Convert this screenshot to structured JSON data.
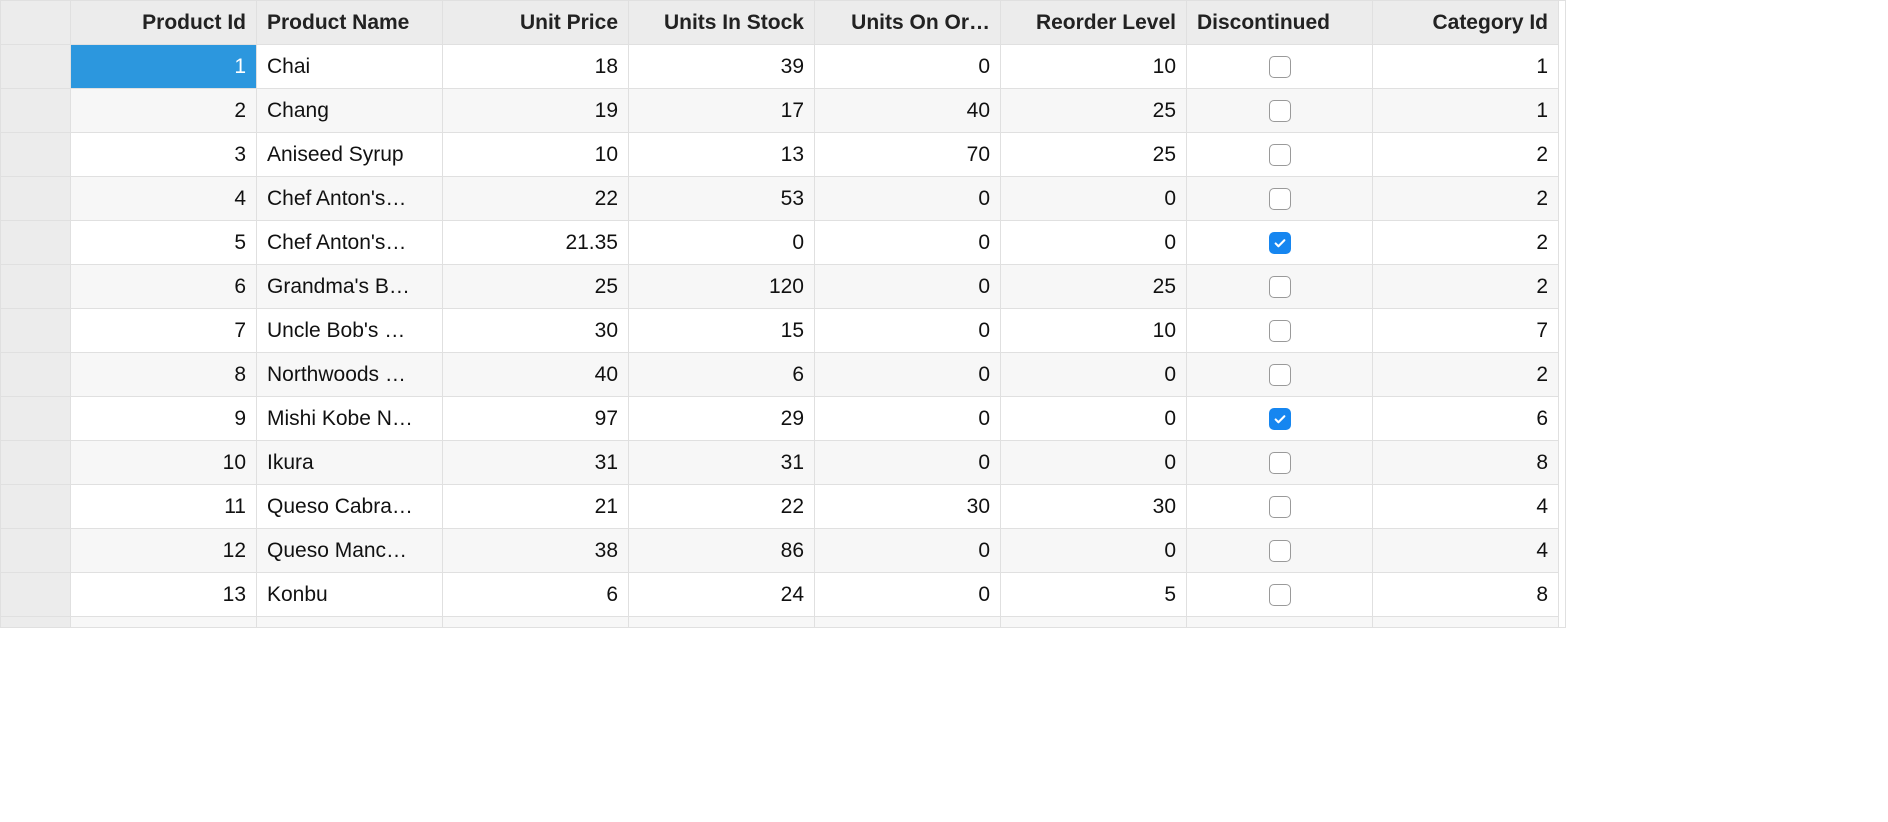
{
  "grid": {
    "columns": [
      {
        "key": "rowheader",
        "label": "",
        "align": "left",
        "type": "rowheader"
      },
      {
        "key": "product_id",
        "label": "Product Id",
        "align": "right",
        "type": "number"
      },
      {
        "key": "product_name",
        "label": "Product Name",
        "align": "left",
        "type": "text"
      },
      {
        "key": "unit_price",
        "label": "Unit Price",
        "align": "right",
        "type": "number"
      },
      {
        "key": "units_in_stock",
        "label": "Units In Stock",
        "align": "right",
        "type": "number"
      },
      {
        "key": "units_on_order",
        "label": "Units On Or…",
        "align": "right",
        "type": "number"
      },
      {
        "key": "reorder_level",
        "label": "Reorder Level",
        "align": "right",
        "type": "number"
      },
      {
        "key": "discontinued",
        "label": "Discontinued",
        "align": "center",
        "type": "bool"
      },
      {
        "key": "category_id",
        "label": "Category Id",
        "align": "right",
        "type": "number"
      }
    ],
    "selected_cell": {
      "row_index": 0,
      "col_key": "product_id"
    },
    "rows": [
      {
        "product_id": "1",
        "product_name": "Chai",
        "unit_price": "18",
        "units_in_stock": "39",
        "units_on_order": "0",
        "reorder_level": "10",
        "discontinued": false,
        "category_id": "1"
      },
      {
        "product_id": "2",
        "product_name": "Chang",
        "unit_price": "19",
        "units_in_stock": "17",
        "units_on_order": "40",
        "reorder_level": "25",
        "discontinued": false,
        "category_id": "1"
      },
      {
        "product_id": "3",
        "product_name": "Aniseed Syrup",
        "unit_price": "10",
        "units_in_stock": "13",
        "units_on_order": "70",
        "reorder_level": "25",
        "discontinued": false,
        "category_id": "2"
      },
      {
        "product_id": "4",
        "product_name": "Chef Anton's…",
        "unit_price": "22",
        "units_in_stock": "53",
        "units_on_order": "0",
        "reorder_level": "0",
        "discontinued": false,
        "category_id": "2"
      },
      {
        "product_id": "5",
        "product_name": "Chef Anton's…",
        "unit_price": "21.35",
        "units_in_stock": "0",
        "units_on_order": "0",
        "reorder_level": "0",
        "discontinued": true,
        "category_id": "2"
      },
      {
        "product_id": "6",
        "product_name": "Grandma's B…",
        "unit_price": "25",
        "units_in_stock": "120",
        "units_on_order": "0",
        "reorder_level": "25",
        "discontinued": false,
        "category_id": "2"
      },
      {
        "product_id": "7",
        "product_name": "Uncle Bob's …",
        "unit_price": "30",
        "units_in_stock": "15",
        "units_on_order": "0",
        "reorder_level": "10",
        "discontinued": false,
        "category_id": "7"
      },
      {
        "product_id": "8",
        "product_name": "Northwoods …",
        "unit_price": "40",
        "units_in_stock": "6",
        "units_on_order": "0",
        "reorder_level": "0",
        "discontinued": false,
        "category_id": "2"
      },
      {
        "product_id": "9",
        "product_name": "Mishi Kobe N…",
        "unit_price": "97",
        "units_in_stock": "29",
        "units_on_order": "0",
        "reorder_level": "0",
        "discontinued": true,
        "category_id": "6"
      },
      {
        "product_id": "10",
        "product_name": "Ikura",
        "unit_price": "31",
        "units_in_stock": "31",
        "units_on_order": "0",
        "reorder_level": "0",
        "discontinued": false,
        "category_id": "8"
      },
      {
        "product_id": "11",
        "product_name": "Queso Cabra…",
        "unit_price": "21",
        "units_in_stock": "22",
        "units_on_order": "30",
        "reorder_level": "30",
        "discontinued": false,
        "category_id": "4"
      },
      {
        "product_id": "12",
        "product_name": "Queso Manc…",
        "unit_price": "38",
        "units_in_stock": "86",
        "units_on_order": "0",
        "reorder_level": "0",
        "discontinued": false,
        "category_id": "4"
      },
      {
        "product_id": "13",
        "product_name": "Konbu",
        "unit_price": "6",
        "units_in_stock": "24",
        "units_on_order": "0",
        "reorder_level": "5",
        "discontinued": false,
        "category_id": "8"
      }
    ]
  }
}
